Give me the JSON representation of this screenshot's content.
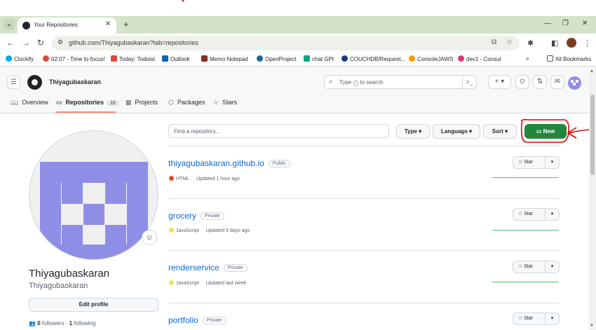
{
  "browser": {
    "tab_title": "Your Repositories",
    "url": "github.com/Thiyagubaskaran?tab=repositories"
  },
  "bookmarks": [
    {
      "label": "Clockify",
      "color": "#03a9f4"
    },
    {
      "label": "02:07 - Time to focus!",
      "color": "#e04a36"
    },
    {
      "label": "Today: Todoist",
      "color": "#db4c3f"
    },
    {
      "label": "Outlook",
      "color": "#0a64c2"
    },
    {
      "label": "Memo Notepad",
      "color": "#8b2b1f"
    },
    {
      "label": "OpenProject",
      "color": "#1a67a3"
    },
    {
      "label": "chat GPt",
      "color": "#10a37f"
    },
    {
      "label": "COUCHDB/Request...",
      "color": "#1a3c6e"
    },
    {
      "label": "ConsoleJAWS",
      "color": "#ff9900"
    },
    {
      "label": "dev1 - Consul",
      "color": "#e03875"
    }
  ],
  "all_bookmarks": "All Bookmarks",
  "header": {
    "context_user": "Thiyagubaskaran",
    "search_prefix": "Type",
    "search_key": "/",
    "search_suffix": "to search"
  },
  "nav": {
    "overview": "Overview",
    "repositories": "Repositories",
    "repositories_count": "10",
    "projects": "Projects",
    "packages": "Packages",
    "stars": "Stars"
  },
  "profile": {
    "name": "Thiyagubaskaran",
    "login": "Thiyagubaskaran",
    "edit_label": "Edit profile",
    "followers_count": "0",
    "followers_label": "followers",
    "following_count": "1",
    "following_label": "following"
  },
  "filters": {
    "search_placeholder": "Find a repository...",
    "type_label": "Type",
    "language_label": "Language",
    "sort_label": "Sort",
    "new_label": "New"
  },
  "repos": [
    {
      "name": "thiyagubaskaran.github.io",
      "visibility": "Public",
      "language": "HTML",
      "lang_color": "#e34c26",
      "updated": "Updated 1 hour ago",
      "star_label": "Star"
    },
    {
      "name": "grocery",
      "visibility": "Private",
      "language": "JavaScript",
      "lang_color": "#f1e05a",
      "updated": "Updated 5 days ago",
      "star_label": "Star"
    },
    {
      "name": "renderservice",
      "visibility": "Private",
      "language": "JavaScript",
      "lang_color": "#f1e05a",
      "updated": "Updated last week",
      "star_label": "Star"
    },
    {
      "name": "portfolio",
      "visibility": "Private",
      "language": "",
      "lang_color": "",
      "updated": "",
      "star_label": "Star"
    }
  ],
  "annotation_color": "#e00000"
}
